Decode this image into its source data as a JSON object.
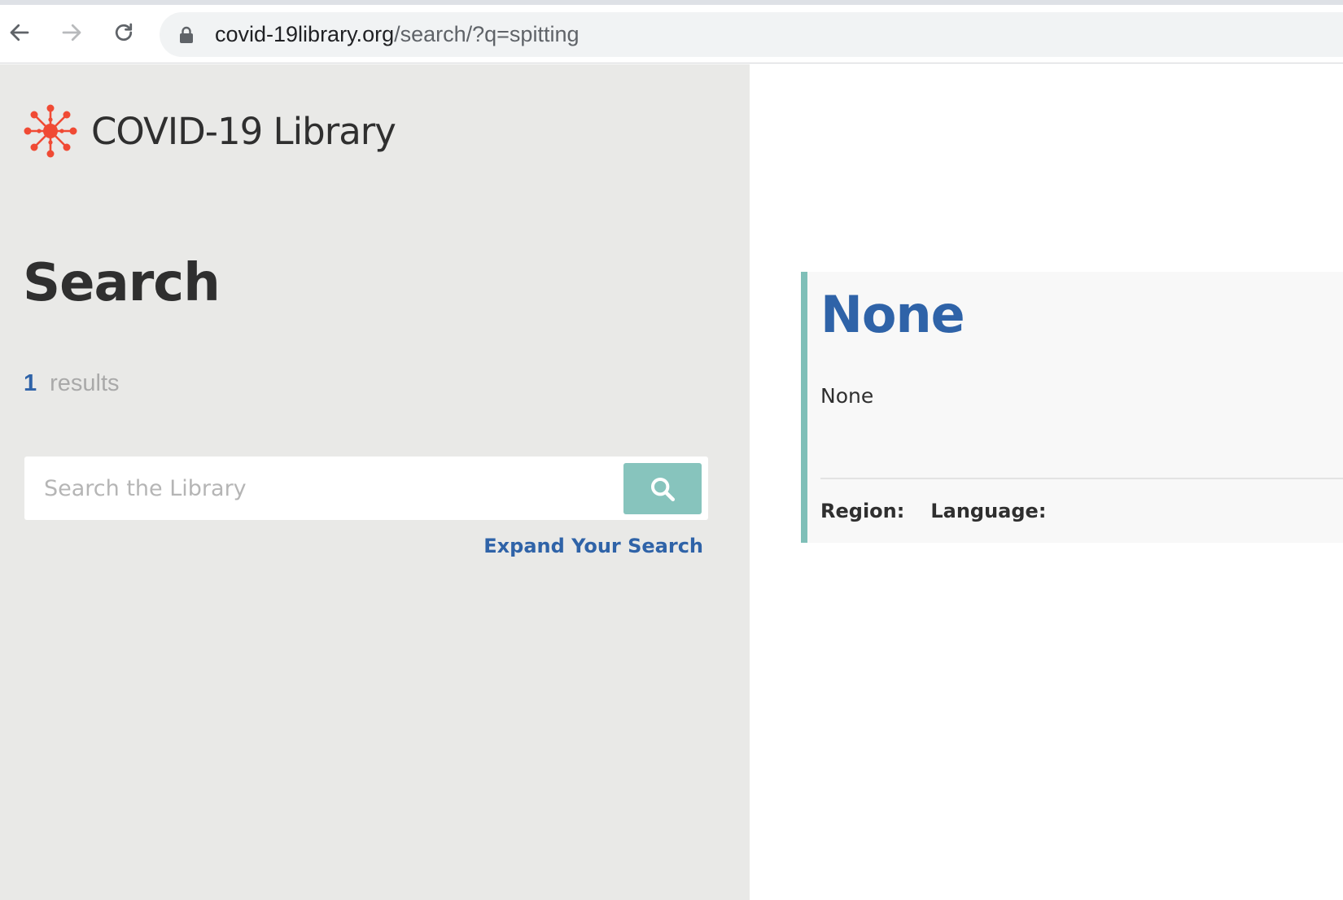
{
  "browser": {
    "url_host": "covid-19library.org",
    "url_path": "/search/?q=spitting",
    "icons": {
      "back": "arrow-left-icon",
      "forward": "arrow-right-icon",
      "reload": "reload-icon",
      "secure": "lock-icon"
    }
  },
  "sidebar": {
    "logo_text": "COVID-19 Library",
    "page_title": "Search",
    "results_count": "1",
    "results_label": "results",
    "search_placeholder": "Search the Library",
    "search_value": "",
    "expand_link": "Expand Your Search"
  },
  "result": {
    "title": "None",
    "description": "None",
    "region_label": "Region:",
    "language_label": "Language:"
  },
  "colors": {
    "brand_red": "#f04a34",
    "link_blue": "#2f63a8",
    "teal": "#87c4bd",
    "sidebar_bg": "#e9e9e7"
  }
}
